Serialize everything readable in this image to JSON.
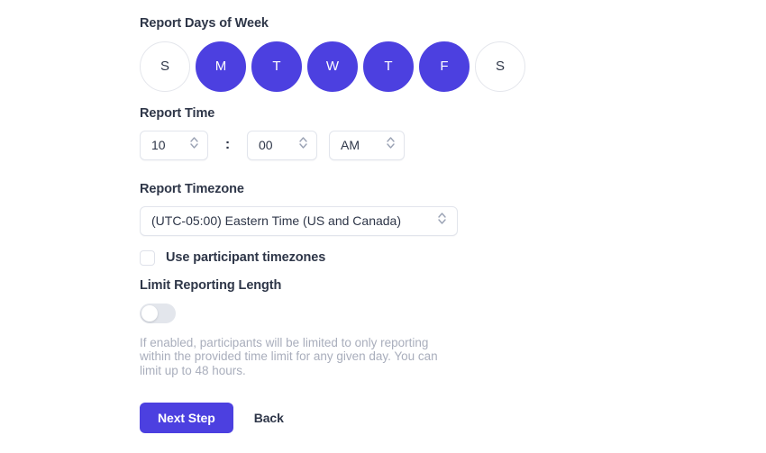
{
  "colors": {
    "accent": "#4c40e0",
    "label_text": "#2e3648",
    "muted_text": "#a9aebc",
    "border": "#e2e5ec",
    "toggle_track_off": "#e3e6ec"
  },
  "days": {
    "label": "Report Days of Week",
    "items": [
      {
        "letter": "S",
        "name": "sunday",
        "selected": false
      },
      {
        "letter": "M",
        "name": "monday",
        "selected": true
      },
      {
        "letter": "T",
        "name": "tuesday",
        "selected": true
      },
      {
        "letter": "W",
        "name": "wednesday",
        "selected": true
      },
      {
        "letter": "T",
        "name": "thursday",
        "selected": true
      },
      {
        "letter": "F",
        "name": "friday",
        "selected": true
      },
      {
        "letter": "S",
        "name": "saturday",
        "selected": false
      }
    ]
  },
  "time": {
    "label": "Report Time",
    "hour": "10",
    "separator": ":",
    "minute": "00",
    "meridiem": "AM",
    "stepper_icon": "chevron-up-down-icon"
  },
  "timezone": {
    "label": "Report Timezone",
    "selected": "(UTC-05:00) Eastern Time (US and Canada)",
    "dropdown_icon": "chevron-up-down-icon",
    "participant_checkbox": {
      "label": "Use participant timezones",
      "checked": false
    }
  },
  "limit": {
    "label": "Limit Reporting Length",
    "toggle_enabled": false,
    "help_text": "If enabled, participants will be limited to only reporting within the provided time limit for any given day. You can limit up to 48 hours."
  },
  "actions": {
    "primary_label": "Next Step",
    "secondary_label": "Back"
  }
}
